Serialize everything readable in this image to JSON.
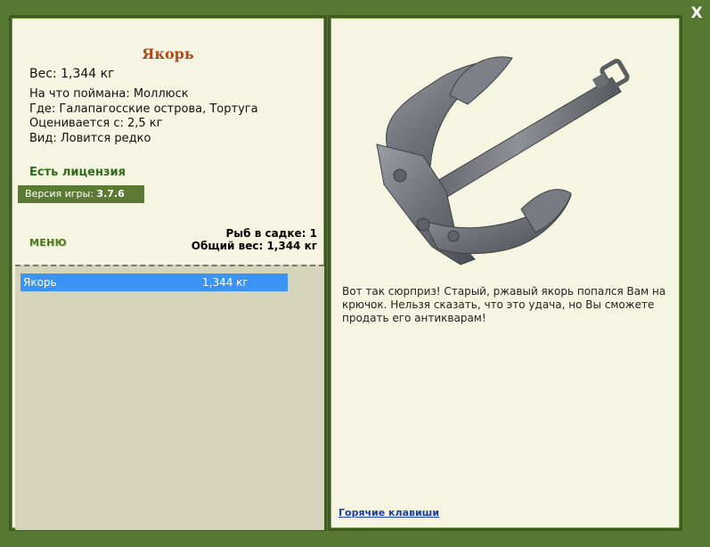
{
  "window": {
    "close_label": "X"
  },
  "item": {
    "title": "Якорь",
    "weight": "Вес: 1,344 кг",
    "caught_on": "На что поймана: Моллюск",
    "location": "Где: Галапагосские острова, Тортуга",
    "value": "Оценивается с: 2,5 кг",
    "kind": "Вид: Ловится редко"
  },
  "license": {
    "label": "Есть лицензия"
  },
  "version": {
    "label": "Версия игры:",
    "number": "3.7.6"
  },
  "menu": {
    "label": "МЕНЮ"
  },
  "stats": {
    "fish_count": "Рыб в садке: 1",
    "total_weight": "Общий вес: 1,344 кг"
  },
  "catch_list": [
    {
      "name": "Якорь",
      "weight": "1,344 кг"
    }
  ],
  "description": "Вот так сюрприз! Старый, ржавый якорь попался Вам на крючок. Нельзя сказать, что это удача, но Вы сможете продать его антикварам!",
  "hotkeys": {
    "label": "Горячие клавиши"
  },
  "colors": {
    "frame": "#567832",
    "panel": "#f6f5e2",
    "title": "#b5481a",
    "license": "#2f6b1a",
    "selection": "#3b93f4",
    "link": "#1a3fa3"
  },
  "icons": {
    "close": "close-icon",
    "item_image": "anchor-image"
  }
}
